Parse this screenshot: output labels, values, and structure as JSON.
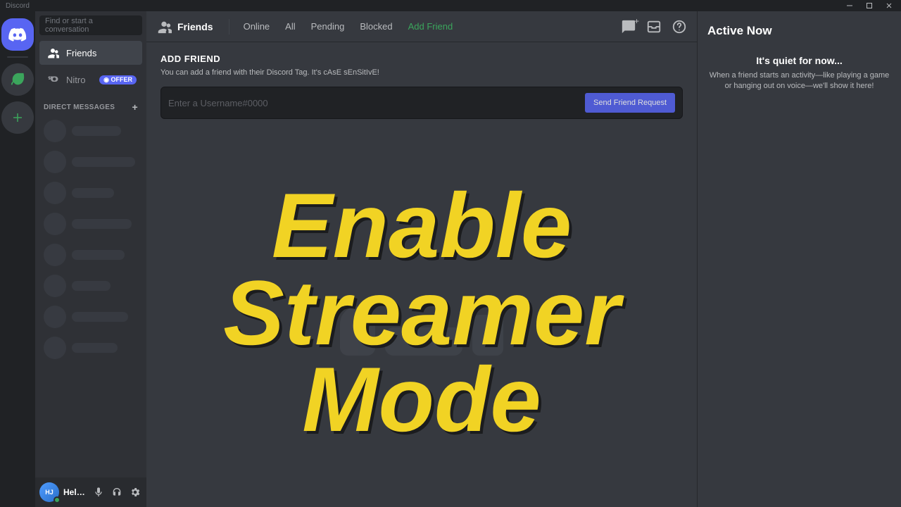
{
  "window": {
    "title": "Discord"
  },
  "sidebar": {
    "search_placeholder": "Find or start a conversation",
    "items": [
      {
        "label": "Friends"
      },
      {
        "label": "Nitro",
        "badge": "◉ OFFER"
      }
    ],
    "dm_header": "DIRECT MESSAGES"
  },
  "topbar": {
    "title": "Friends",
    "tabs": [
      {
        "label": "Online"
      },
      {
        "label": "All"
      },
      {
        "label": "Pending"
      },
      {
        "label": "Blocked"
      },
      {
        "label": "Add Friend"
      }
    ]
  },
  "add_friend": {
    "title": "ADD FRIEND",
    "desc": "You can add a friend with their Discord Tag. It's cAsE sEnSitIvE!",
    "placeholder": "Enter a Username#0000",
    "button": "Send Friend Request"
  },
  "active_now": {
    "title": "Active Now",
    "quiet_title": "It's quiet for now...",
    "quiet_desc": "When a friend starts an activity—like playing a game or hanging out on voice—we'll show it here!"
  },
  "user": {
    "name": "Helper Joel"
  },
  "overlay": {
    "line1": "Enable",
    "line2": "Streamer",
    "line3": "Mode"
  },
  "icon_names": {
    "discord": "discord-logo-icon",
    "green_server": "server-green-icon",
    "add_server": "add-server-icon"
  }
}
